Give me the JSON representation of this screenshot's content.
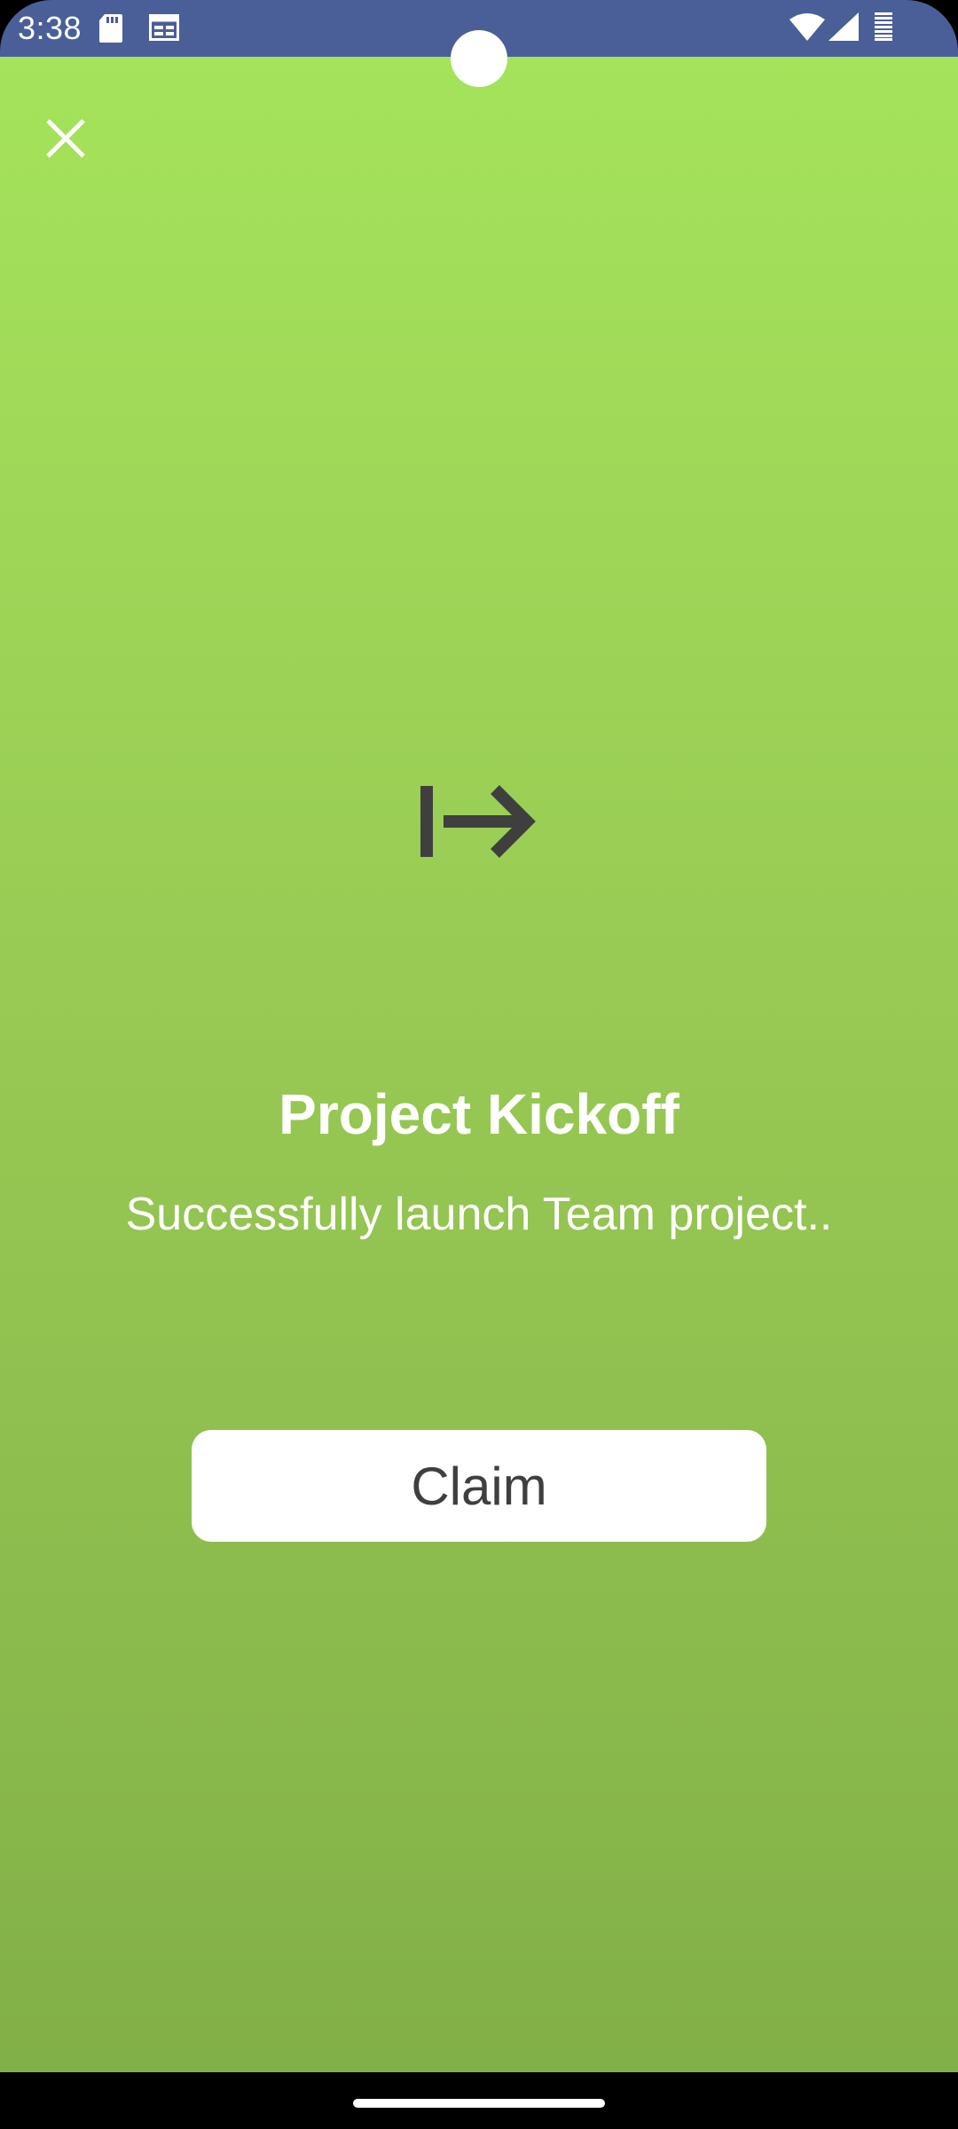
{
  "status_bar": {
    "time": "3:38",
    "icons": [
      "sd-card-icon",
      "calendar-notification-icon",
      "wifi-icon",
      "cellular-signal-icon",
      "battery-icon"
    ]
  },
  "toolbar": {
    "close_icon": "close-icon"
  },
  "achievement": {
    "icon": "tab-arrow-right-icon",
    "title": "Project Kickoff",
    "description": "Successfully launch Team project.."
  },
  "actions": {
    "claim_label": "Claim"
  },
  "colors": {
    "status_bar": "#4a5e98",
    "background_top": "#a5e35b",
    "background_bottom": "#82b048",
    "icon": "#3f3f3f",
    "button_bg": "#ffffff",
    "button_text": "#3f3f3f"
  }
}
